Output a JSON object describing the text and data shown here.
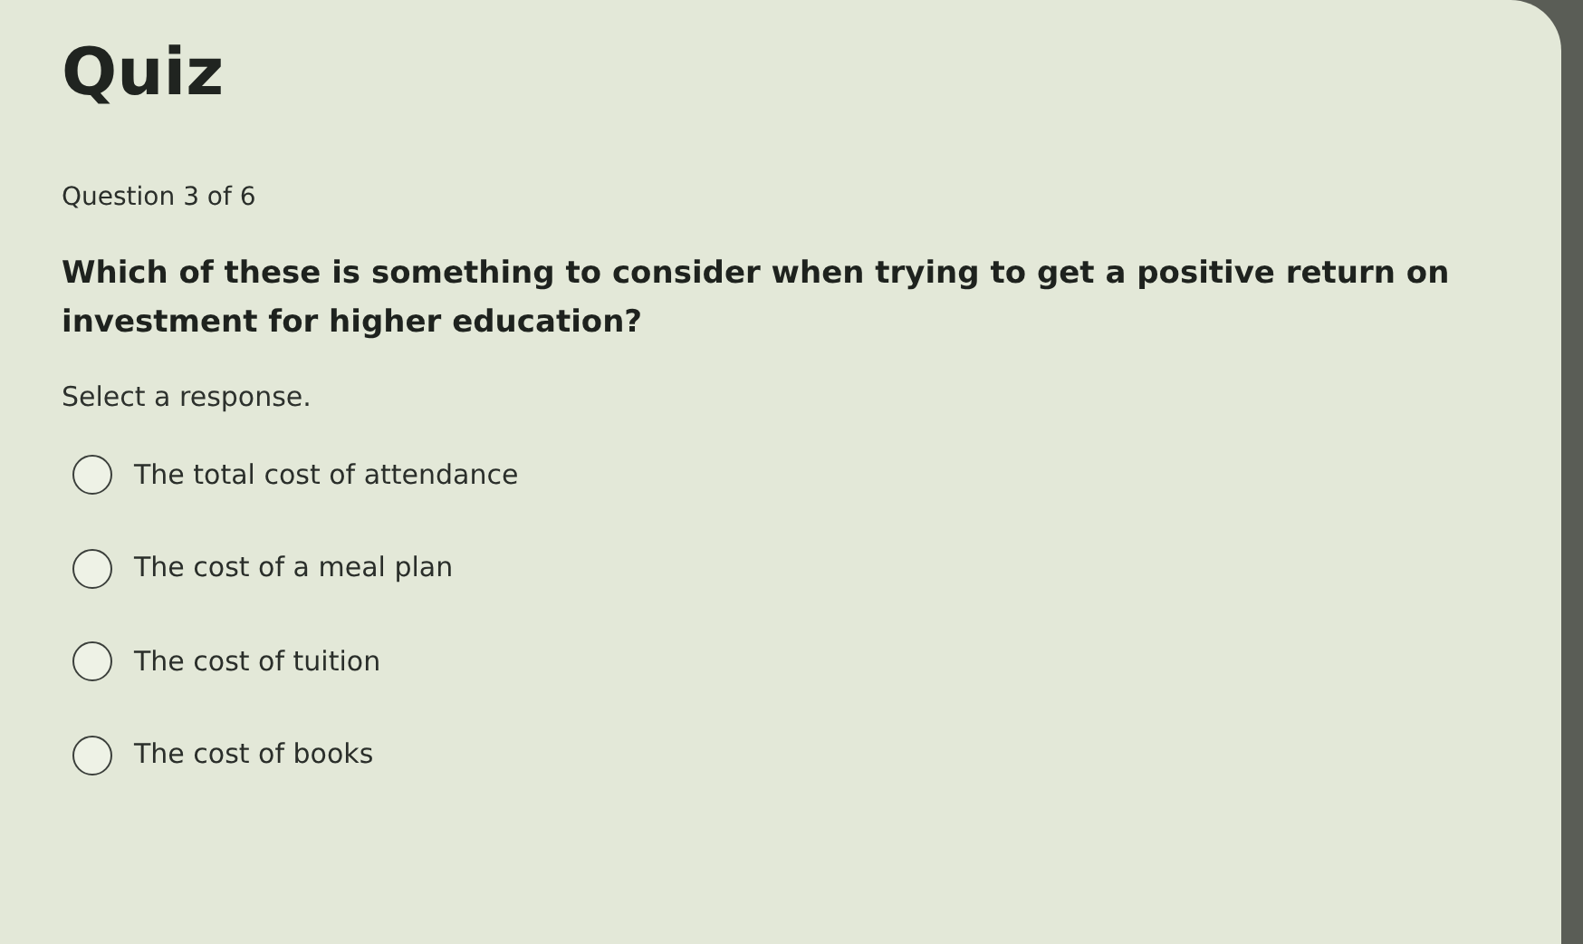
{
  "title": "Quiz",
  "progress": "Question 3 of 6",
  "question": "Which of these is something to consider when trying to get a positive return on investment for higher education?",
  "instruction": "Select a response.",
  "options": [
    {
      "label": "The total cost of attendance",
      "selected": false
    },
    {
      "label": "The cost of a meal plan",
      "selected": false
    },
    {
      "label": "The cost of tuition",
      "selected": false
    },
    {
      "label": "The cost of books",
      "selected": false
    }
  ]
}
